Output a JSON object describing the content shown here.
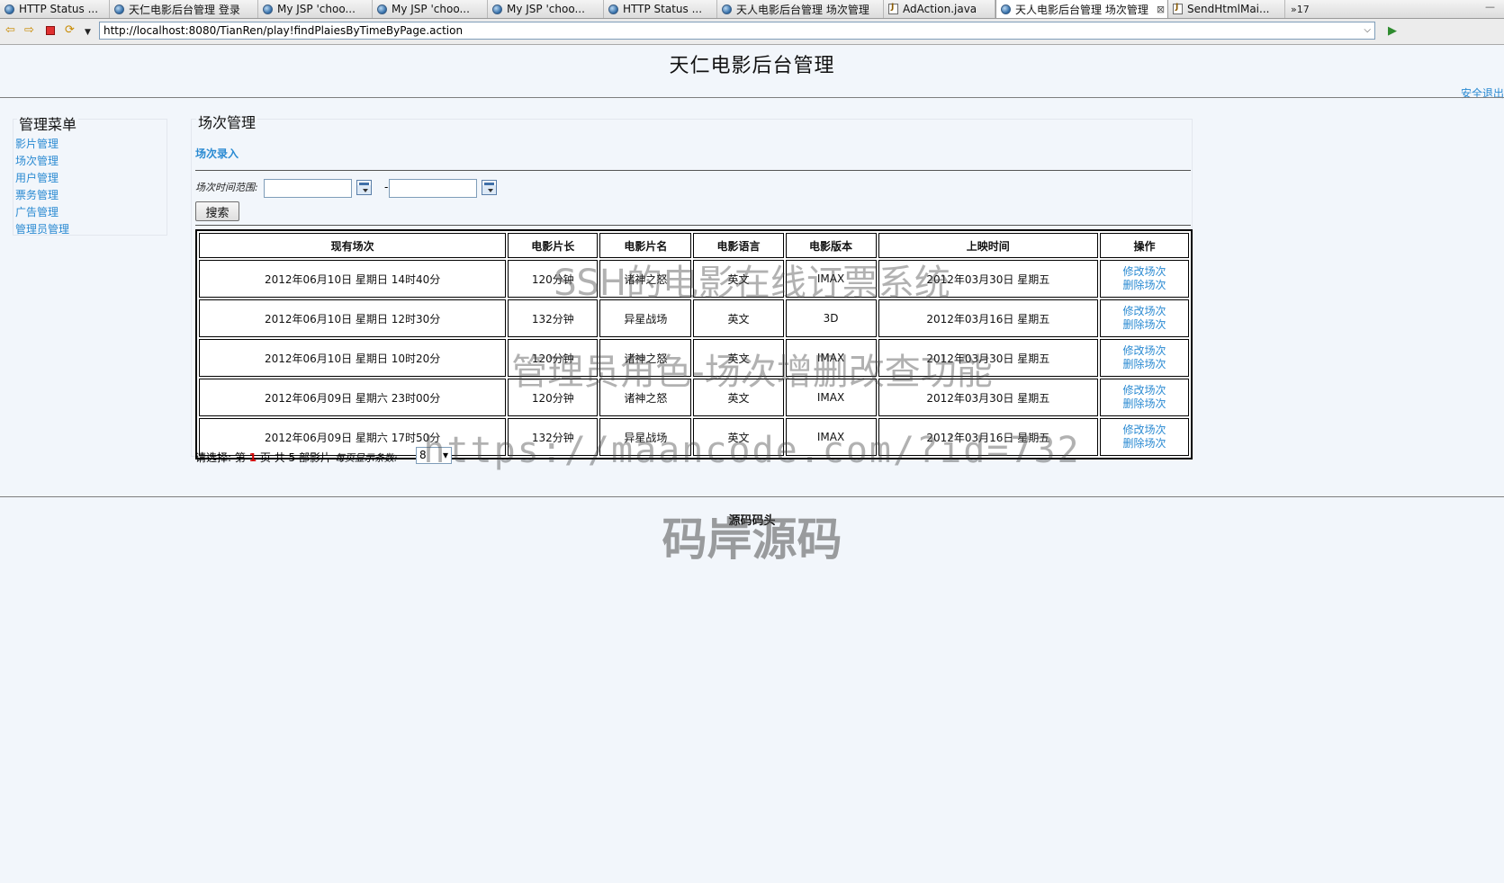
{
  "browser": {
    "tabs": [
      {
        "label": "HTTP Status ...",
        "icon": "globe-icon",
        "active": false
      },
      {
        "label": "天仁电影后台管理 登录",
        "icon": "globe-icon",
        "active": false
      },
      {
        "label": "My JSP 'choo...",
        "icon": "globe-icon",
        "active": false
      },
      {
        "label": "My JSP 'choo...",
        "icon": "globe-icon",
        "active": false
      },
      {
        "label": "My JSP 'choo...",
        "icon": "globe-icon",
        "active": false
      },
      {
        "label": "HTTP Status ...",
        "icon": "globe-icon",
        "active": false
      },
      {
        "label": "天人电影后台管理 场次管理",
        "icon": "globe-icon",
        "active": false
      },
      {
        "label": "AdAction.java",
        "icon": "java-file-icon",
        "active": false
      },
      {
        "label": "天人电影后台管理 场次管理",
        "icon": "globe-icon",
        "active": true
      },
      {
        "label": "SendHtmlMai...",
        "icon": "java-file-icon",
        "active": false
      }
    ],
    "tab_overflow": "»17",
    "url": "http://localhost:8080/TianRen/play!findPlaiesByTimeByPage.action"
  },
  "header": {
    "title": "天仁电影后台管理",
    "logout": "安全退出"
  },
  "sidebar": {
    "title": "管理菜单",
    "items": [
      {
        "label": "影片管理"
      },
      {
        "label": "场次管理"
      },
      {
        "label": "用户管理"
      },
      {
        "label": "票务管理"
      },
      {
        "label": "广告管理"
      },
      {
        "label": "管理员管理"
      }
    ]
  },
  "main": {
    "title": "场次管理",
    "entry_link": "场次录入",
    "filter": {
      "label": "场次时间范围:",
      "start_value": "",
      "end_value": "",
      "separator": "--",
      "search_label": "搜索"
    },
    "table": {
      "columns": [
        "现有场次",
        "电影片长",
        "电影片名",
        "电影语言",
        "电影版本",
        "上映时间",
        "操作"
      ],
      "rows": [
        {
          "showtime": "2012年06月10日 星期日 14时40分",
          "length": "120分钟",
          "name": "诸神之怒",
          "language": "英文",
          "version": "IMAX",
          "release": "2012年03月30日 星期五",
          "edit": "修改场次",
          "delete": "删除场次"
        },
        {
          "showtime": "2012年06月10日 星期日 12时30分",
          "length": "132分钟",
          "name": "异星战场",
          "language": "英文",
          "version": "3D",
          "release": "2012年03月16日 星期五",
          "edit": "修改场次",
          "delete": "删除场次"
        },
        {
          "showtime": "2012年06月10日 星期日 10时20分",
          "length": "120分钟",
          "name": "诸神之怒",
          "language": "英文",
          "version": "IMAX",
          "release": "2012年03月30日 星期五",
          "edit": "修改场次",
          "delete": "删除场次"
        },
        {
          "showtime": "2012年06月09日 星期六 23时00分",
          "length": "120分钟",
          "name": "诸神之怒",
          "language": "英文",
          "version": "IMAX",
          "release": "2012年03月30日 星期五",
          "edit": "修改场次",
          "delete": "删除场次"
        },
        {
          "showtime": "2012年06月09日 星期六 17时50分",
          "length": "132分钟",
          "name": "异星战场",
          "language": "英文",
          "version": "IMAX",
          "release": "2012年03月16日 星期五",
          "edit": "修改场次",
          "delete": "删除场次"
        }
      ]
    },
    "pager": {
      "prefix": "请选择: 第",
      "current_page": "1",
      "middle": "页 共",
      "total": "5",
      "suffix": "部影片",
      "per_page_label": "每页显示条数:",
      "per_page_value": "8"
    }
  },
  "footer": {
    "text": "源码码头"
  },
  "watermarks": {
    "line1": "SSH的电影在线订票系统",
    "line2": "管理员角色-场次增删改查功能",
    "line3": "https://maancode.com/?id=732",
    "line4": "码岸源码"
  },
  "colors": {
    "link": "#2a8ad2",
    "page_bg": "#f2f6fb",
    "current_page": "#d00000"
  }
}
